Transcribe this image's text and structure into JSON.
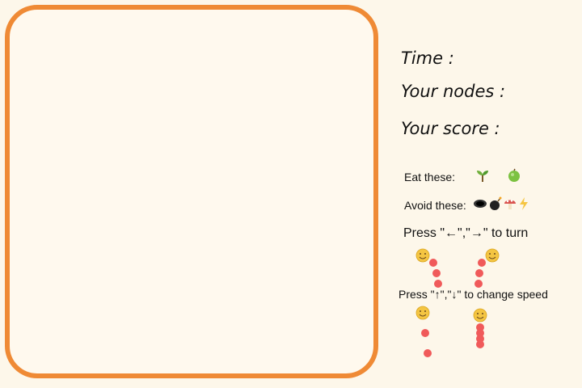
{
  "stats": {
    "time_label": "Time :",
    "nodes_label": "Your nodes :",
    "score_label": "Your score :"
  },
  "legend": {
    "eat_label": "Eat these:",
    "eat_icons": [
      "sprout-icon",
      "green-apple-icon"
    ],
    "avoid_label": "Avoid these:",
    "avoid_icons": [
      "hole-icon",
      "bomb-icon",
      "mushroom-icon",
      "lightning-icon"
    ]
  },
  "instructions": {
    "turn": "Press \"←\",\"→\" to turn",
    "speed": "Press \"↑\",\"↓\" to change speed"
  },
  "colors": {
    "board_border": "#ef8a35",
    "snake_body": "#f05a5a",
    "snake_head": "#f4c542"
  }
}
